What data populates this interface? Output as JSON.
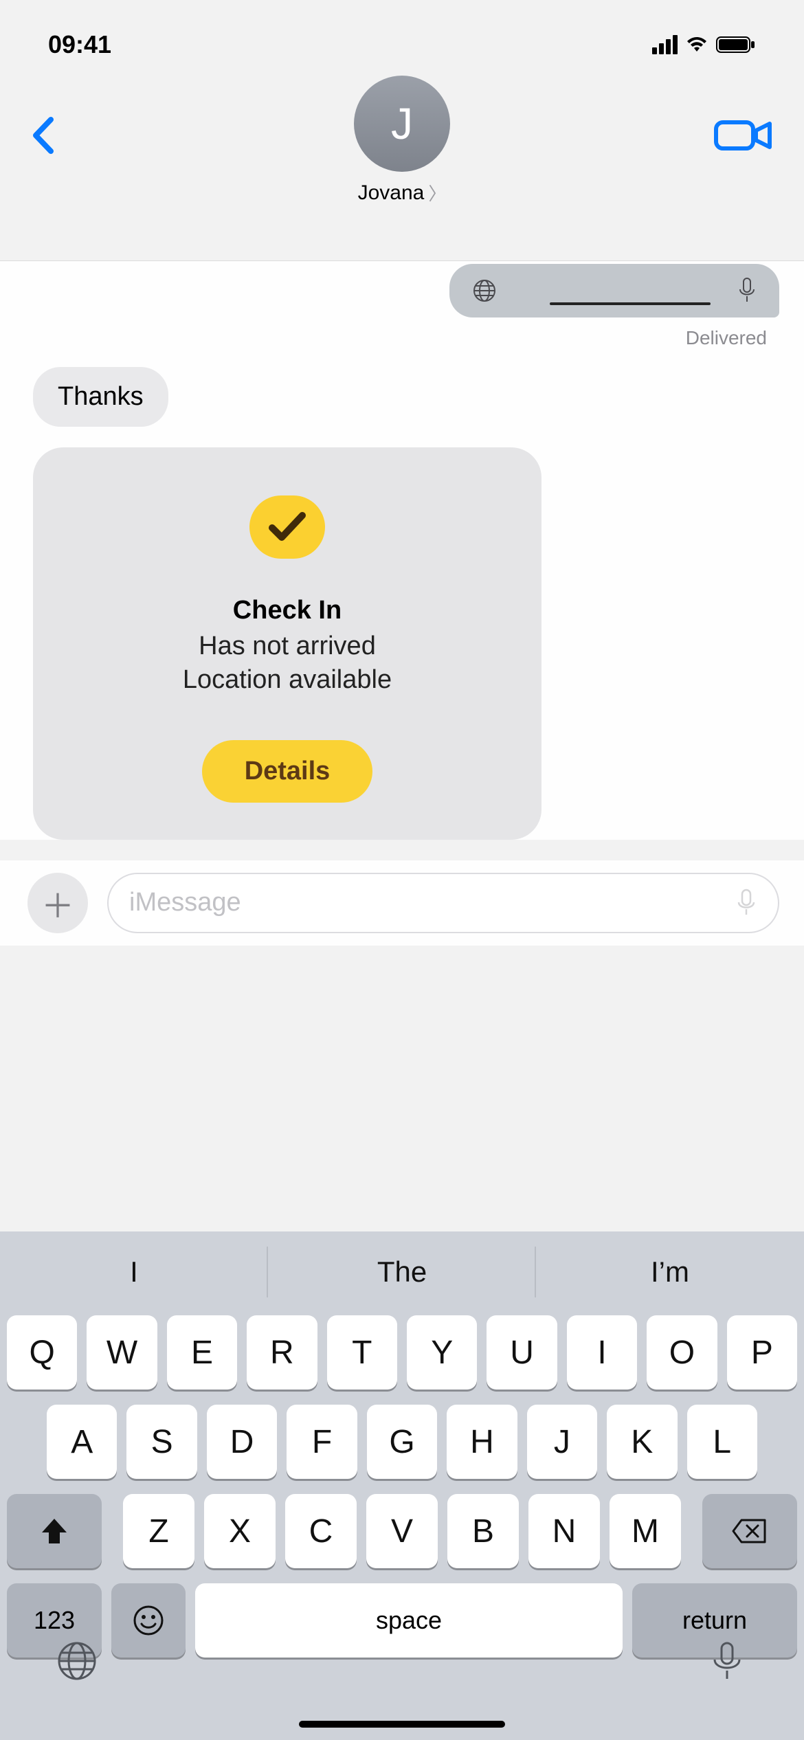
{
  "status": {
    "time": "09:41"
  },
  "header": {
    "avatar_initial": "J",
    "contact_name": "Jovana"
  },
  "messages": {
    "delivered_label": "Delivered",
    "incoming_text": "Thanks",
    "checkin": {
      "title": "Check In",
      "line1": "Has not arrived",
      "line2": "Location available",
      "details_label": "Details"
    }
  },
  "input": {
    "placeholder": "iMessage"
  },
  "keyboard": {
    "suggestions": [
      "I",
      "The",
      "I’m"
    ],
    "row1": [
      "Q",
      "W",
      "E",
      "R",
      "T",
      "Y",
      "U",
      "I",
      "O",
      "P"
    ],
    "row2": [
      "A",
      "S",
      "D",
      "F",
      "G",
      "H",
      "J",
      "K",
      "L"
    ],
    "row3": [
      "Z",
      "X",
      "C",
      "V",
      "B",
      "N",
      "M"
    ],
    "numbers_label": "123",
    "space_label": "space",
    "return_label": "return"
  }
}
